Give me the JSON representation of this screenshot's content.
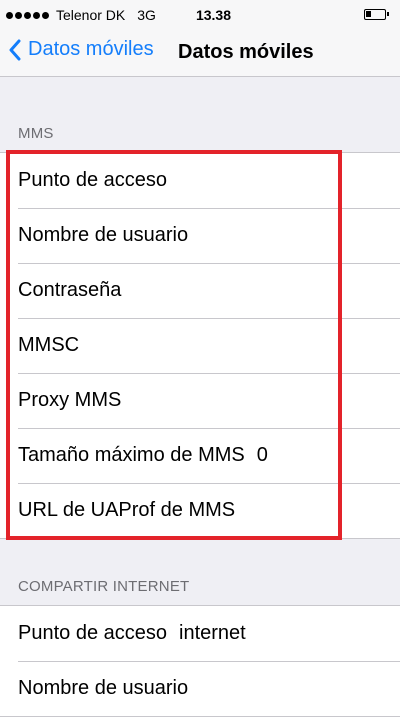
{
  "status_bar": {
    "carrier": "Telenor DK",
    "network": "3G",
    "time": "13.38"
  },
  "nav": {
    "back_label": "Datos móviles",
    "title": "Datos móviles"
  },
  "mms": {
    "header": "MMS",
    "rows": [
      {
        "label": "Punto de acceso",
        "value": ""
      },
      {
        "label": "Nombre de usuario",
        "value": ""
      },
      {
        "label": "Contraseña",
        "value": ""
      },
      {
        "label": "MMSC",
        "value": ""
      },
      {
        "label": "Proxy MMS",
        "value": ""
      },
      {
        "label": "Tamaño máximo de MMS",
        "value": "0"
      },
      {
        "label": "URL de UAProf de MMS",
        "value": ""
      }
    ]
  },
  "tethering": {
    "header": "COMPARTIR INTERNET",
    "rows": [
      {
        "label": "Punto de acceso",
        "value": "internet"
      },
      {
        "label": "Nombre de usuario",
        "value": ""
      }
    ]
  },
  "colors": {
    "accent": "#147efb",
    "highlight": "#e3232a",
    "background": "#efeff4"
  }
}
